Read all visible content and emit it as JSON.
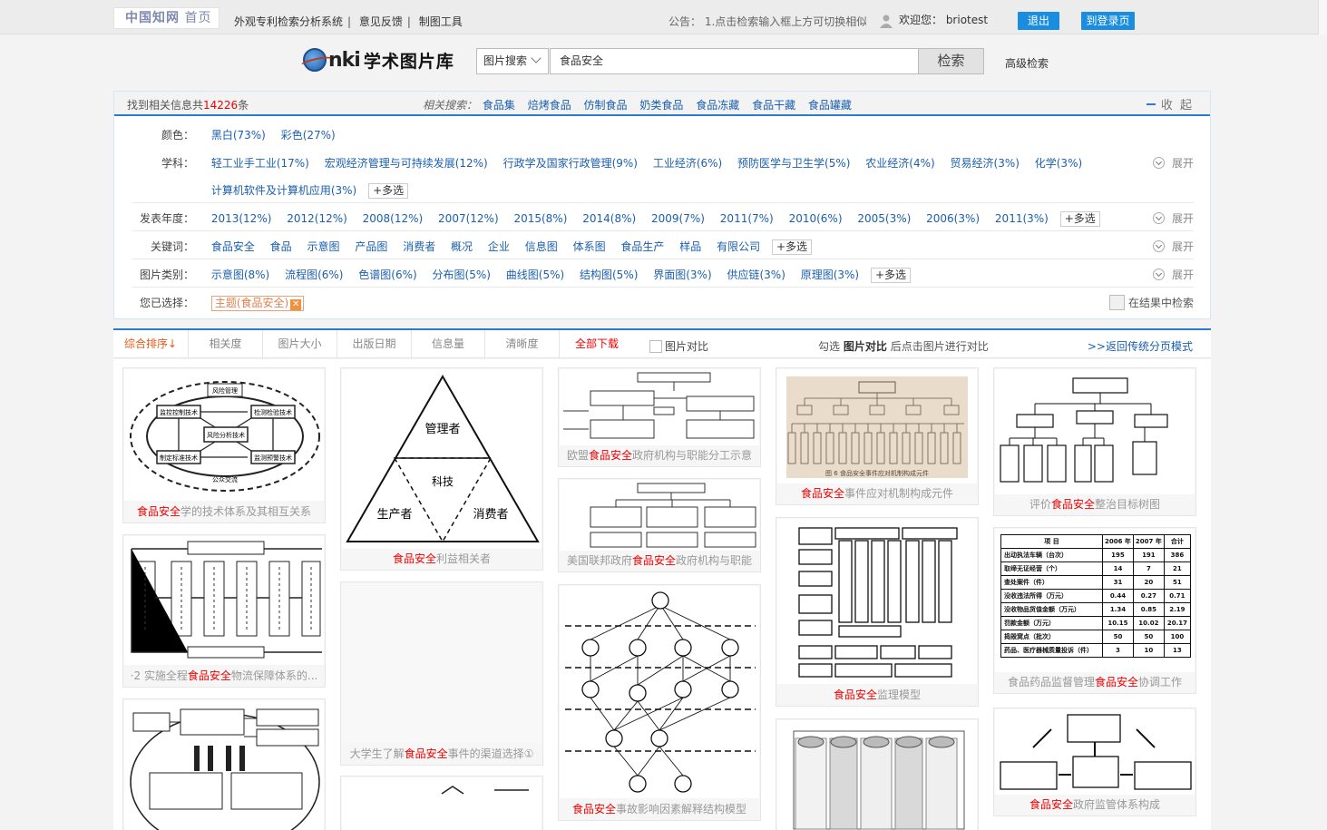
{
  "topbar": {
    "logo_a": "中国知网",
    "logo_b": "首页",
    "links": [
      "外观专利检索分析系统",
      "意见反馈",
      "制图工具"
    ],
    "notice": "公告： 1.点击检索输入框上方可切换相似",
    "welcome": "欢迎您： briotest",
    "logout": "退出",
    "login_page": "到登录页"
  },
  "search": {
    "brand": "学术图片库",
    "brand_prefix": "nki",
    "type": "图片搜索",
    "query": "食品安全",
    "button": "检索",
    "advanced": "高级检索"
  },
  "summary": {
    "prefix": "找到相关信息共",
    "count": "14226",
    "suffix": "条",
    "related_label": "相关搜索：",
    "related": [
      "食品集",
      "焙烤食品",
      "仿制食品",
      "奶类食品",
      "食品冻藏",
      "食品干藏",
      "食品罐藏"
    ],
    "collapse": "收 起"
  },
  "filters": {
    "color": {
      "label": "颜色：",
      "items": [
        "黑白(73%)",
        "彩色(27%)"
      ]
    },
    "subject": {
      "label": "学科：",
      "items": [
        "轻工业手工业(17%)",
        "宏观经济管理与可持续发展(12%)",
        "行政学及国家行政管理(9%)",
        "工业经济(6%)",
        "预防医学与卫生学(5%)",
        "农业经济(4%)",
        "贸易经济(3%)",
        "化学(3%)"
      ],
      "items2": [
        "计算机软件及计算机应用(3%)"
      ]
    },
    "year": {
      "label": "发表年度：",
      "items": [
        "2013(12%)",
        "2012(12%)",
        "2008(12%)",
        "2007(12%)",
        "2015(8%)",
        "2014(8%)",
        "2009(7%)",
        "2011(7%)",
        "2010(6%)",
        "2005(3%)",
        "2006(3%)",
        "2011(3%)"
      ]
    },
    "keyword": {
      "label": "关键词：",
      "items": [
        "食品安全",
        "食品",
        "示意图",
        "产品图",
        "消费者",
        "概况",
        "企业",
        "信息图",
        "体系图",
        "食品生产",
        "样品",
        "有限公司"
      ]
    },
    "category": {
      "label": "图片类别：",
      "items": [
        "示意图(8%)",
        "流程图(6%)",
        "色谱图(6%)",
        "分布图(5%)",
        "曲线图(5%)",
        "结构图(5%)",
        "界面图(3%)",
        "供应链(3%)",
        "原理图(3%)"
      ]
    },
    "multi": "+多选",
    "expand": "展开",
    "selected_label": "您已选择：",
    "selected_tag": "主题(食品安全)",
    "in_result": "在结果中检索"
  },
  "sort": {
    "tabs": [
      "综合排序↓",
      "相关度",
      "图片大小",
      "出版日期",
      "信息量",
      "清晰度",
      "全部下载"
    ],
    "compare": "图片对比",
    "hint_pre": "勾选",
    "hint_bold": "图片对比",
    "hint_post": "后点击图片进行对比",
    "back": ">>返回传统分页模式"
  },
  "results": [
    {
      "pre": "",
      "hl": "食品安全",
      "post": "学的技术体系及其相互关系"
    },
    {
      "pre": "·2   实施全程",
      "hl": "食品安全",
      "post": "物流保障体系的..."
    },
    {
      "pre": "",
      "hl": "",
      "post": ""
    },
    {
      "pre": "",
      "hl": "食品安全",
      "post": "利益相关者"
    },
    {
      "pre": "大学生了解",
      "hl": "食品安全",
      "post": "事件的渠道选择①"
    },
    {
      "pre": "欧盟",
      "hl": "食品安全",
      "post": "政府机构与职能分工示意"
    },
    {
      "pre": "美国联邦政府",
      "hl": "食品安全",
      "post": "政府机构与职能"
    },
    {
      "pre": "",
      "hl": "食品安全",
      "post": "事故影响因素解释结构模型"
    },
    {
      "pre": "",
      "hl": "食品安全",
      "post": "事件应对机制构成元件"
    },
    {
      "pre": "",
      "hl": "食品安全",
      "post": "监理模型"
    },
    {
      "pre": "评价",
      "hl": "食品安全",
      "post": "整治目标树图"
    },
    {
      "pre": "食品药品监督管理",
      "hl": "食品安全",
      "post": "协调工作"
    },
    {
      "pre": "",
      "hl": "食品安全",
      "post": "政府监管体系构成"
    }
  ],
  "diagram_text": {
    "risk_mgmt": "风险管理",
    "risk_analysis": "风险分析技术",
    "monitor": "监控控制技术",
    "test": "检测检验技术",
    "std": "制定标准技术",
    "warn": "监测预警技术",
    "public": "公众交流",
    "manager": "管理者",
    "science": "科技",
    "producer": "生产者",
    "consumer": "消费者",
    "fig6": "图 6   食品安全事件应对机制构成元件",
    "table_head": [
      "项  目",
      "2006 年",
      "2007 年",
      "合计"
    ],
    "table_rows": [
      [
        "出动执法车辆（台次）",
        "195",
        "191",
        "386"
      ],
      [
        "取缔无证经营（个）",
        "14",
        "7",
        "21"
      ],
      [
        "查处案件（件）",
        "31",
        "20",
        "51"
      ],
      [
        "没收违法所得（万元）",
        "0.44",
        "0.27",
        "0.71"
      ],
      [
        "没收物品货值金额（万元）",
        "1.34",
        "0.85",
        "2.19"
      ],
      [
        "罚款金额（万元）",
        "10.15",
        "10.02",
        "20.17"
      ],
      [
        "捣毁窝点（批次）",
        "50",
        "50",
        "100"
      ],
      [
        "药品、医疗器械质量投诉（件）",
        "3",
        "10",
        "13"
      ]
    ]
  }
}
